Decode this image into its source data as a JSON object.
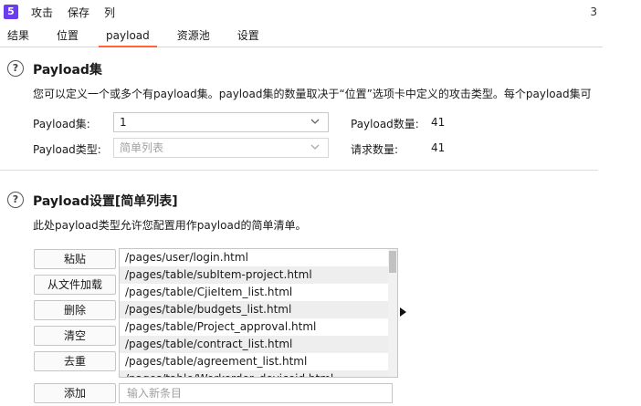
{
  "menubar": {
    "logo": "5",
    "items": [
      "攻击",
      "保存",
      "列"
    ],
    "right_text": "3"
  },
  "tabs": [
    {
      "label": "结果",
      "active": false
    },
    {
      "label": "位置",
      "active": false
    },
    {
      "label": "payload",
      "active": true
    },
    {
      "label": "资源池",
      "active": false
    },
    {
      "label": "设置",
      "active": false
    }
  ],
  "payload_sets": {
    "icon": "help-icon",
    "title": "Payload集",
    "description": "您可以定义一个或多个有payload集。payload集的数量取决于“位置”选项卡中定义的攻击类型。每个payload集可",
    "set_label": "Payload集:",
    "set_value": "1",
    "type_label": "Payload类型:",
    "type_value": "简单列表",
    "count_label": "Payload数量:",
    "count_value": "41",
    "requests_label": "请求数量:",
    "requests_value": "41"
  },
  "payload_settings": {
    "icon": "help-icon",
    "title": "Payload设置[简单列表]",
    "description": "此处payload类型允许您配置用作payload的简单清单。",
    "buttons": {
      "paste": "粘贴",
      "load": "从文件加载",
      "remove": "删除",
      "clear": "清空",
      "dedupe": "去重",
      "add": "添加"
    },
    "items": [
      "/pages/user/login.html",
      "/pages/table/subItem-project.html",
      "/pages/table/CjieItem_list.html",
      "/pages/table/budgets_list.html",
      "/pages/table/Project_approval.html",
      "/pages/table/contract_list.html",
      "/pages/table/agreement_list.html",
      "/pages/table/Workorder_deviceid.html"
    ],
    "new_item_placeholder": "输入新条目"
  }
}
